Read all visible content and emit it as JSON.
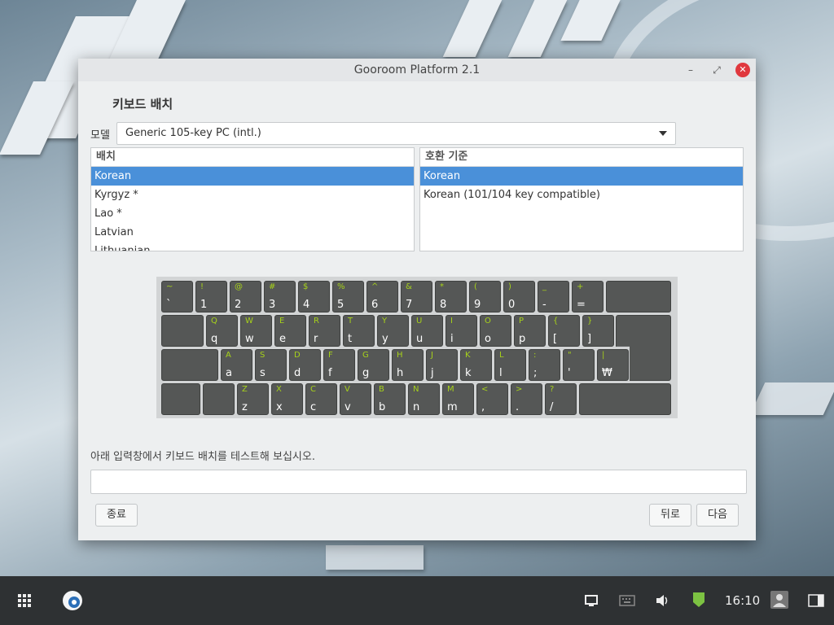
{
  "dialog": {
    "title": "Gooroom Platform 2.1",
    "heading": "키보드 배치",
    "model_label": "모델",
    "model_value": "Generic 105-key PC (intl.)",
    "layout_header": "배치",
    "layouts": [
      "Korean",
      "Kyrgyz *",
      "Lao *",
      "Latvian",
      "Lithuanian"
    ],
    "layout_selected": 0,
    "variant_header": "호환 기준",
    "variants": [
      "Korean",
      "Korean (101/104 key compatible)"
    ],
    "variant_selected": 0,
    "test_label": "아래 입력창에서 키보드 배치를 테스트해 보십시오.",
    "test_value": "",
    "quit_label": "종료",
    "back_label": "뒤로",
    "next_label": "다음"
  },
  "keyboard": {
    "row1": [
      [
        "~",
        "`"
      ],
      [
        "!",
        "1"
      ],
      [
        "@",
        "2"
      ],
      [
        "#",
        "3"
      ],
      [
        "$",
        "4"
      ],
      [
        "%",
        "5"
      ],
      [
        "^",
        "6"
      ],
      [
        "&",
        "7"
      ],
      [
        "*",
        "8"
      ],
      [
        "(",
        "9"
      ],
      [
        ")",
        "0"
      ],
      [
        "_",
        "-"
      ],
      [
        "+",
        "="
      ]
    ],
    "row2": [
      [
        "Q",
        "q"
      ],
      [
        "W",
        "w"
      ],
      [
        "E",
        "e"
      ],
      [
        "R",
        "r"
      ],
      [
        "T",
        "t"
      ],
      [
        "Y",
        "y"
      ],
      [
        "U",
        "u"
      ],
      [
        "I",
        "i"
      ],
      [
        "O",
        "o"
      ],
      [
        "P",
        "p"
      ],
      [
        "{",
        "["
      ],
      [
        "}",
        "]"
      ]
    ],
    "row3": [
      [
        "A",
        "a"
      ],
      [
        "S",
        "s"
      ],
      [
        "D",
        "d"
      ],
      [
        "F",
        "f"
      ],
      [
        "G",
        "g"
      ],
      [
        "H",
        "h"
      ],
      [
        "J",
        "j"
      ],
      [
        "K",
        "k"
      ],
      [
        "L",
        "l"
      ],
      [
        ":",
        ";"
      ],
      [
        "\"",
        "'"
      ],
      [
        "|",
        "₩"
      ]
    ],
    "row4": [
      [
        "Z",
        "z"
      ],
      [
        "X",
        "x"
      ],
      [
        "C",
        "c"
      ],
      [
        "V",
        "v"
      ],
      [
        "B",
        "b"
      ],
      [
        "N",
        "n"
      ],
      [
        "M",
        "m"
      ],
      [
        "<",
        ","
      ],
      [
        ">",
        "."
      ],
      [
        "?",
        "/"
      ]
    ]
  },
  "taskbar": {
    "clock": "16:10",
    "icons": [
      "apps-grid-icon",
      "browser-icon",
      "display-icon",
      "keyboard-icon",
      "volume-icon",
      "security-shield-icon",
      "user-icon",
      "notification-panel-icon"
    ],
    "accent": "#4a90d9",
    "shield_color": "#7cc242"
  }
}
